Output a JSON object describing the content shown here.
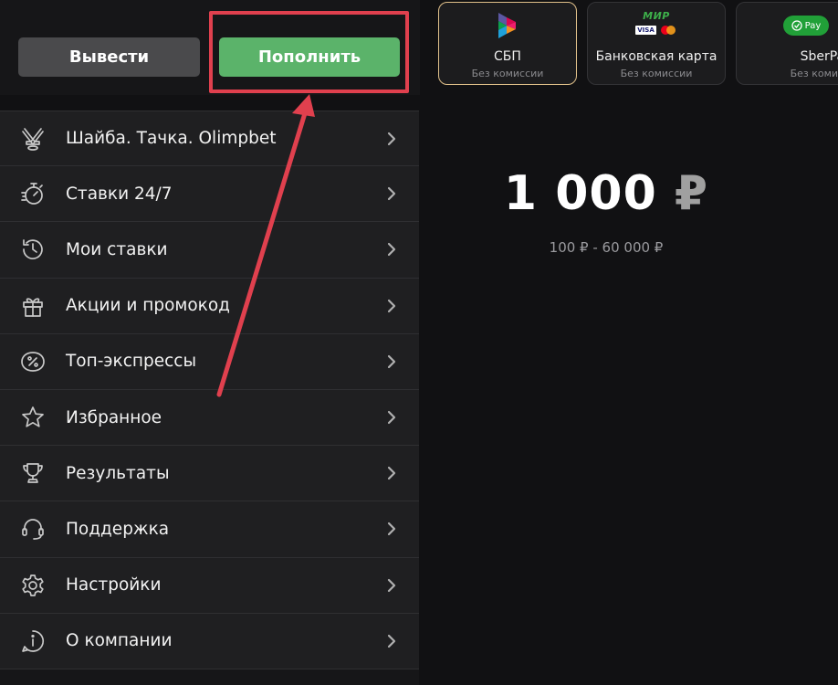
{
  "actions": {
    "withdraw_label": "Вывести",
    "deposit_label": "Пополнить"
  },
  "menu": {
    "items": [
      {
        "label": "Шайба. Тачка. Olimpbet",
        "icon": "hockey-sticks-icon"
      },
      {
        "label": "Ставки 24/7",
        "icon": "stopwatch-icon"
      },
      {
        "label": "Мои ставки",
        "icon": "history-icon"
      },
      {
        "label": "Акции и промокод",
        "icon": "gift-icon"
      },
      {
        "label": "Топ-экспрессы",
        "icon": "percent-coupon-icon"
      },
      {
        "label": "Избранное",
        "icon": "star-icon"
      },
      {
        "label": "Результаты",
        "icon": "trophy-icon"
      },
      {
        "label": "Поддержка",
        "icon": "headset-icon"
      },
      {
        "label": "Настройки",
        "icon": "gear-icon"
      },
      {
        "label": "О компании",
        "icon": "info-icon"
      }
    ]
  },
  "payment_methods": [
    {
      "title": "СБП",
      "subtitle": "Без комиссии",
      "logo": "sbp-logo",
      "selected": true
    },
    {
      "title": "Банковская карта",
      "subtitle": "Без комиссии",
      "logo": "mir-visa-mastercard-logo",
      "selected": false,
      "logo_text": "МИР",
      "visa_text": "VISA"
    },
    {
      "title": "SberPay",
      "subtitle": "Без комиссии",
      "logo": "sberpay-logo",
      "selected": false,
      "logo_text": "Pay"
    }
  ],
  "deposit": {
    "amount": "1 000",
    "currency": "₽",
    "range": "100 ₽ - 60 000 ₽"
  },
  "colors": {
    "deposit_button": "#5bb36a",
    "withdraw_button": "#4a4a4c",
    "highlight": "#e0404e",
    "selected_card_border": "#e0c08a"
  }
}
